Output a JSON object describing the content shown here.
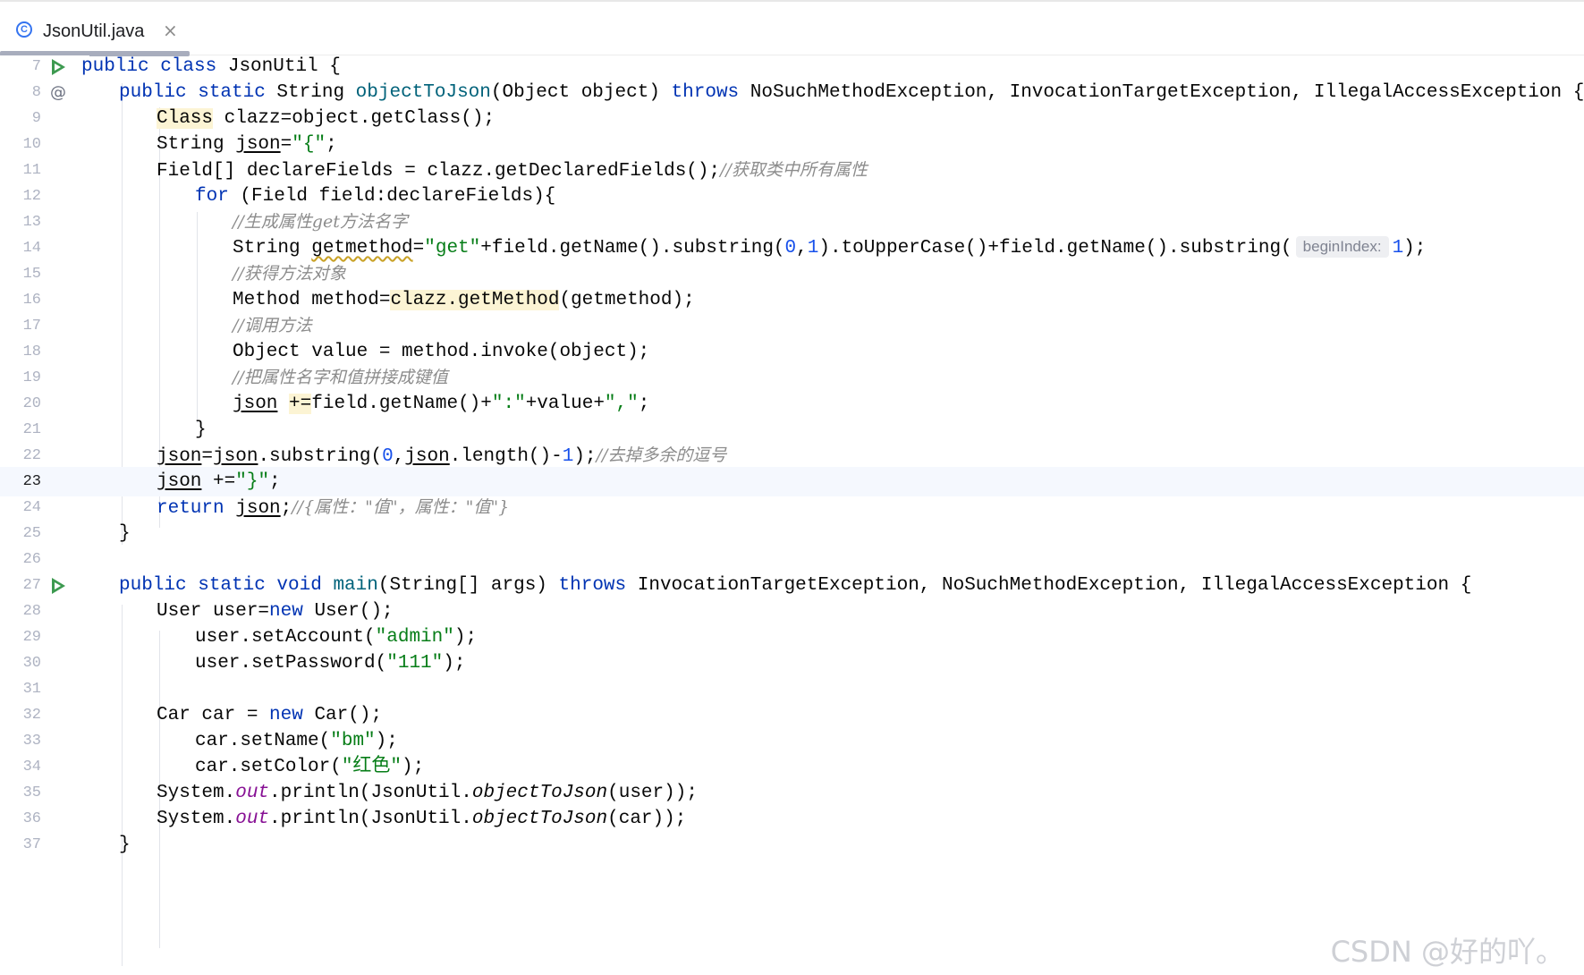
{
  "tab": {
    "icon": "class-c-icon",
    "icon_glyph": "C",
    "label": "JsonUtil.java",
    "close": "×"
  },
  "gutter": {
    "line_numbers": [
      "7",
      "8",
      "9",
      "10",
      "11",
      "12",
      "13",
      "14",
      "15",
      "16",
      "17",
      "18",
      "19",
      "20",
      "21",
      "22",
      "23",
      "24",
      "25",
      "26",
      "27",
      "28",
      "29",
      "30",
      "31",
      "32",
      "33",
      "34",
      "35",
      "36",
      "37"
    ],
    "current_line": "23",
    "impl_glyph": "@"
  },
  "code": {
    "l7": {
      "kw1": "public class",
      "rest": " JsonUtil {"
    },
    "l8": {
      "kw1": "public static",
      "t1": " String ",
      "fn": "objectToJson",
      "t2": "(Object object) ",
      "kw2": "throws",
      "t3": " NoSuchMethodException, InvocationTargetException, IllegalAccessException {"
    },
    "l9": {
      "cls": "Class",
      "t1": " clazz=object.getClass();"
    },
    "l10": {
      "t1": "String ",
      "v": "json",
      "t2": "=",
      "s": "\"{\"",
      "t3": ";"
    },
    "l11": {
      "t1": "Field[] declareFields = clazz.getDeclaredFields();",
      "c": "//获取类中所有属性"
    },
    "l12": {
      "kw": "for",
      "t1": " (Field field:declareFields){"
    },
    "l13": {
      "c": "//生成属性get方法名字"
    },
    "l14": {
      "t1": "String ",
      "v": "getmethod",
      "t2": "=",
      "s": "\"get\"",
      "t3": "+field.getName().substring(",
      "n1": "0",
      "t4": ",",
      "n2": "1",
      "t5": ").toUpperCase()+field.getName().substring(",
      "hint": "beginIndex:",
      "n3": "1",
      "t6": ");"
    },
    "l15": {
      "c": "//获得方法对象"
    },
    "l16": {
      "t1": "Method method=",
      "h": "clazz.getMethod",
      "t2": "(getmethod);"
    },
    "l17": {
      "c": "//调用方法"
    },
    "l18": {
      "t1": "Object value = method.invoke(object);"
    },
    "l19": {
      "c": "//把属性名字和值拼接成键值"
    },
    "l20": {
      "v": "json",
      "t1": " ",
      "h": "+=",
      "t2": "field.getName()+",
      "s1": "\":\"",
      "t3": "+value+",
      "s2": "\",\"",
      "t4": ";"
    },
    "l21": {
      "t1": "}"
    },
    "l22": {
      "v1": "json",
      "t1": "=",
      "v2": "json",
      "t2": ".substring(",
      "n1": "0",
      "t3": ",",
      "v3": "json",
      "t4": ".length()-",
      "n2": "1",
      "t5": ");",
      "c": "//去掉多余的逗号"
    },
    "l23": {
      "v": "json",
      "t1": " +=",
      "s": "\"}\"",
      "t2": ";"
    },
    "l24": {
      "kw": "return",
      "t1": " ",
      "v": "json",
      "t2": ";",
      "c": "//{属性：\"值\"，属性：\"值\"}"
    },
    "l25": {
      "t1": "}"
    },
    "l27": {
      "kw1": "public static void",
      "t0": " ",
      "fn": "main",
      "t1": "(String[] args) ",
      "kw2": "throws",
      "t2": " InvocationTargetException, NoSuchMethodException, IllegalAccessException {"
    },
    "l28": {
      "t1": "User user=",
      "kw": "new",
      "t2": " User();"
    },
    "l29": {
      "t1": "user.setAccount(",
      "s": "\"admin\"",
      "t2": ");"
    },
    "l30": {
      "t1": "user.setPassword(",
      "s": "\"111\"",
      "t2": ");"
    },
    "l32": {
      "t1": "Car car = ",
      "kw": "new",
      "t2": " Car();"
    },
    "l33": {
      "t1": "car.setName(",
      "s": "\"bm\"",
      "t2": ");"
    },
    "l34": {
      "t1": "car.setColor(",
      "s": "\"红色\"",
      "t2": ");"
    },
    "l35": {
      "t1": "System.",
      "st": "out",
      "t2": ".println(JsonUtil.",
      "it": "objectToJson",
      "t3": "(user));"
    },
    "l36": {
      "t1": "System.",
      "st": "out",
      "t2": ".println(JsonUtil.",
      "it": "objectToJson",
      "t3": "(car));"
    },
    "l37": {
      "t1": "}"
    }
  },
  "watermark": "CSDN @好的吖。",
  "colors": {
    "keyword": "#0033b3",
    "string": "#067d17",
    "number": "#1750eb",
    "comment": "#8c8c8c",
    "run": "#3d9a50",
    "current_line_bg": "#f5f8fe"
  }
}
